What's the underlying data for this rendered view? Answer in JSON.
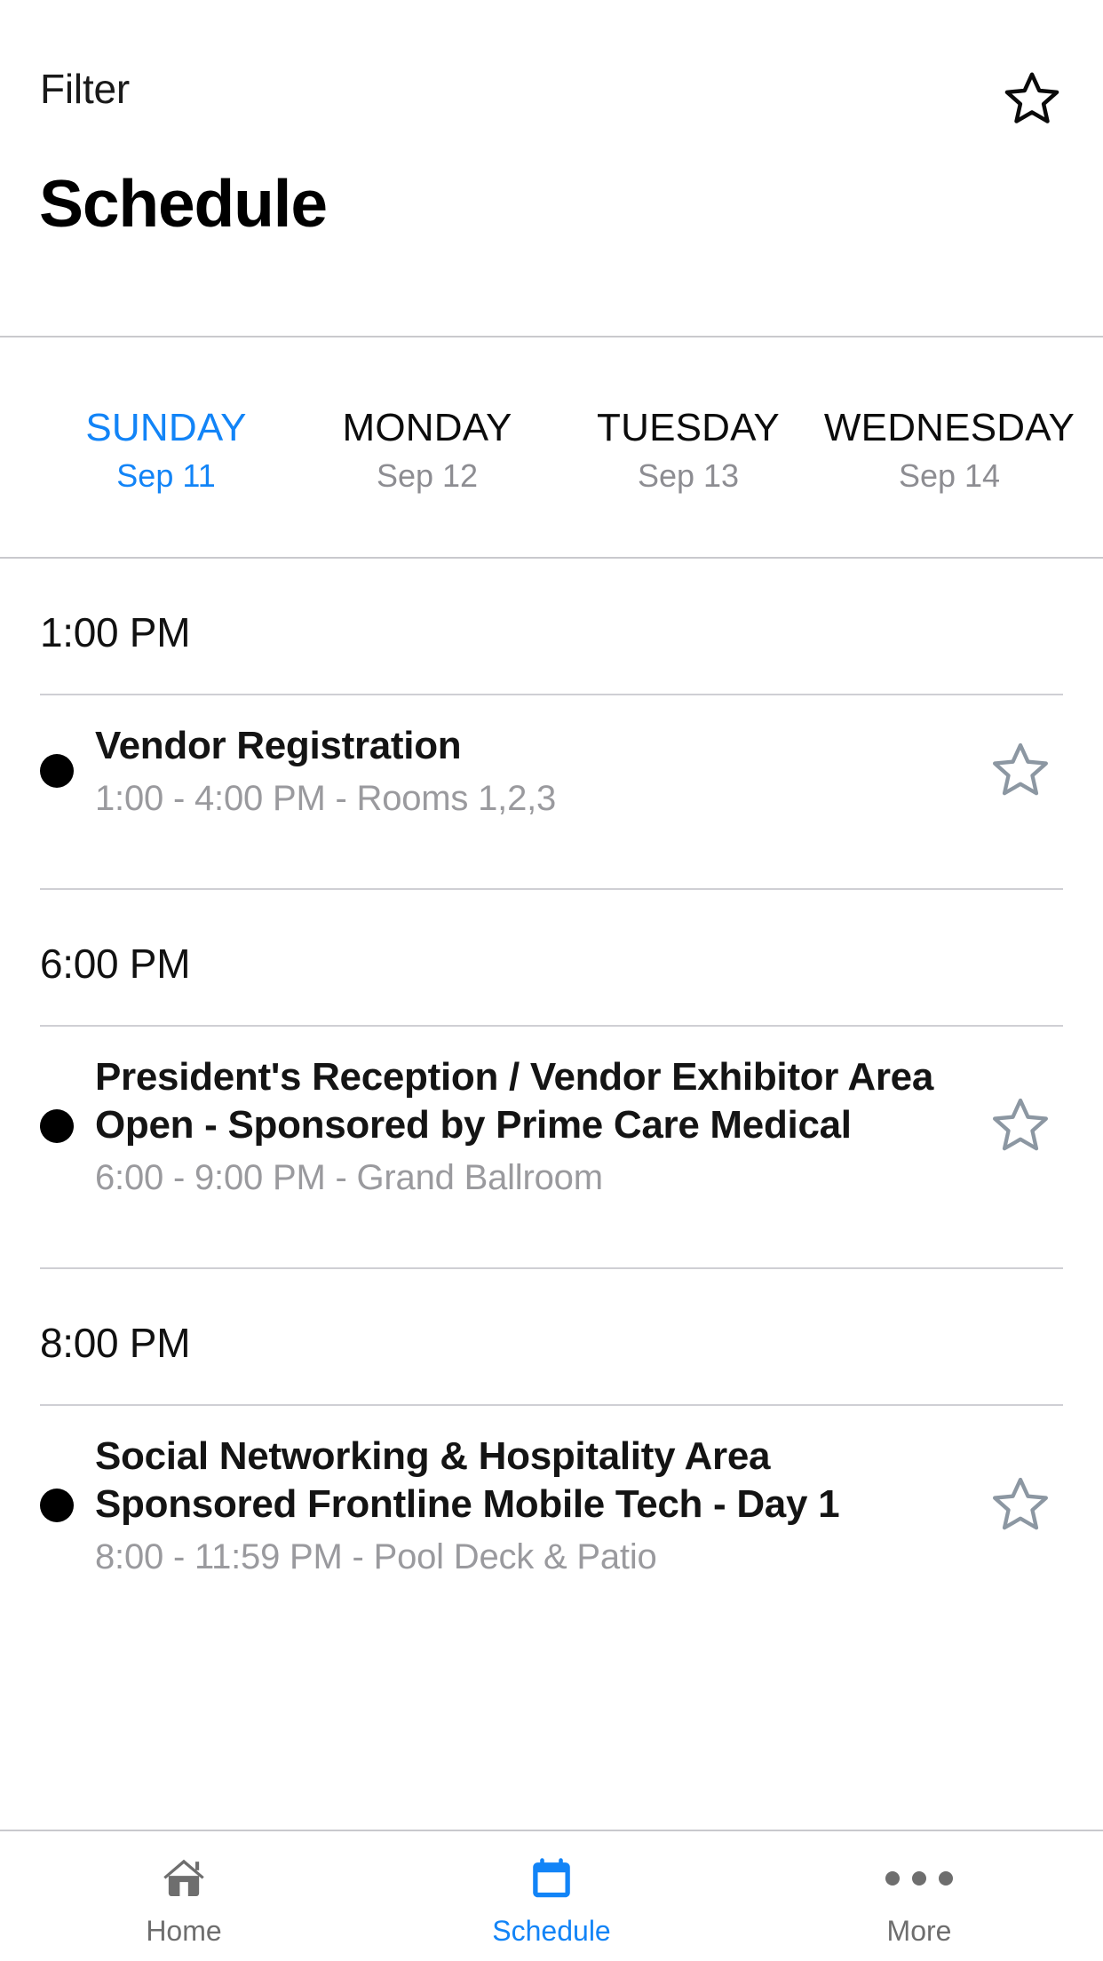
{
  "header": {
    "filter_label": "Filter",
    "favorite_icon": "star-outline-icon",
    "page_title": "Schedule"
  },
  "day_tabs": {
    "active_index": 0,
    "items": [
      {
        "day": "SUNDAY",
        "date": "Sep 11",
        "active": true
      },
      {
        "day": "MONDAY",
        "date": "Sep 12",
        "active": false
      },
      {
        "day": "TUESDAY",
        "date": "Sep 13",
        "active": false
      },
      {
        "day": "WEDNESDAY",
        "date": "Sep 14",
        "active": false
      }
    ]
  },
  "schedule": {
    "sections": [
      {
        "time": "1:00 PM",
        "events": [
          {
            "title": "Vendor Registration",
            "subtitle": "1:00 - 4:00 PM - Rooms 1,2,3",
            "bullet": "filled-dot-icon",
            "favorite_icon": "star-outline-icon",
            "favorited": false
          }
        ]
      },
      {
        "time": "6:00 PM",
        "events": [
          {
            "title": "President's Reception / Vendor Exhibitor Area Open - Sponsored by Prime Care Medical",
            "subtitle": "6:00 - 9:00 PM - Grand Ballroom",
            "bullet": "filled-dot-icon",
            "favorite_icon": "star-outline-icon",
            "favorited": false
          }
        ]
      },
      {
        "time": "8:00 PM",
        "events": [
          {
            "title": "Social Networking & Hospitality Area Sponsored Frontline Mobile Tech - Day 1",
            "subtitle": "8:00 - 11:59 PM - Pool Deck & Patio",
            "bullet": "filled-dot-icon",
            "favorite_icon": "star-outline-icon",
            "favorited": false
          }
        ]
      }
    ]
  },
  "tabbar": {
    "active_index": 1,
    "items": [
      {
        "label": "Home",
        "icon": "home-icon",
        "active": false
      },
      {
        "label": "Schedule",
        "icon": "calendar-icon",
        "active": true
      },
      {
        "label": "More",
        "icon": "ellipsis-icon",
        "active": false
      }
    ]
  },
  "colors": {
    "accent": "#1284f7",
    "text_primary": "#111111",
    "text_secondary": "#9a9a9e",
    "divider": "#c9c9cd",
    "star_outline": "#8c97a2",
    "tab_inactive": "#6e6e6e"
  }
}
